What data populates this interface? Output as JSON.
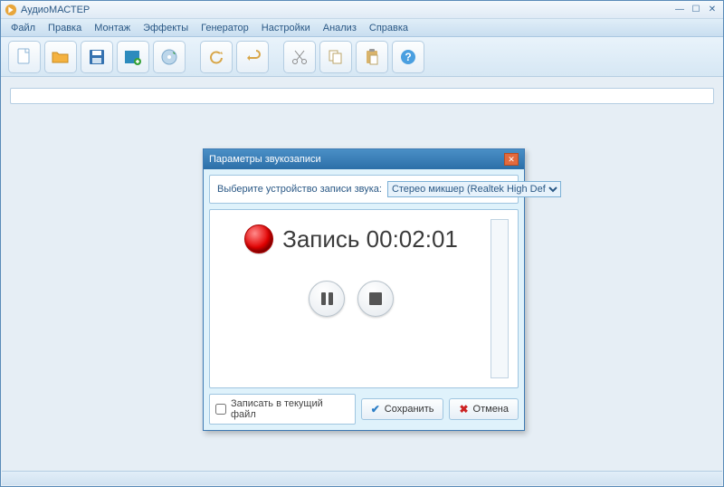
{
  "window": {
    "title": "АудиоМАСТЕР"
  },
  "menu": {
    "file": "Файл",
    "edit": "Правка",
    "montage": "Монтаж",
    "effects": "Эффекты",
    "generator": "Генератор",
    "settings": "Настройки",
    "analysis": "Анализ",
    "help": "Справка"
  },
  "toolbar_icons": {
    "new": "new-file-icon",
    "open": "open-folder-icon",
    "save": "save-floppy-icon",
    "video": "video-plus-icon",
    "cd": "disc-audio-icon",
    "undo_arc": "undo-arc-icon",
    "undo": "undo-icon",
    "cut": "scissors-icon",
    "copy": "copy-icon",
    "paste": "paste-icon",
    "help": "help-icon"
  },
  "dialog": {
    "title": "Параметры звукозаписи",
    "device_label": "Выберите устройство записи звука:",
    "device_selected": "Стерео микшер (Realtek High Def",
    "status_word": "Запись",
    "timer": "00:02:01",
    "write_current": "Записать в текущий файл",
    "save": "Сохранить",
    "cancel": "Отмена"
  }
}
